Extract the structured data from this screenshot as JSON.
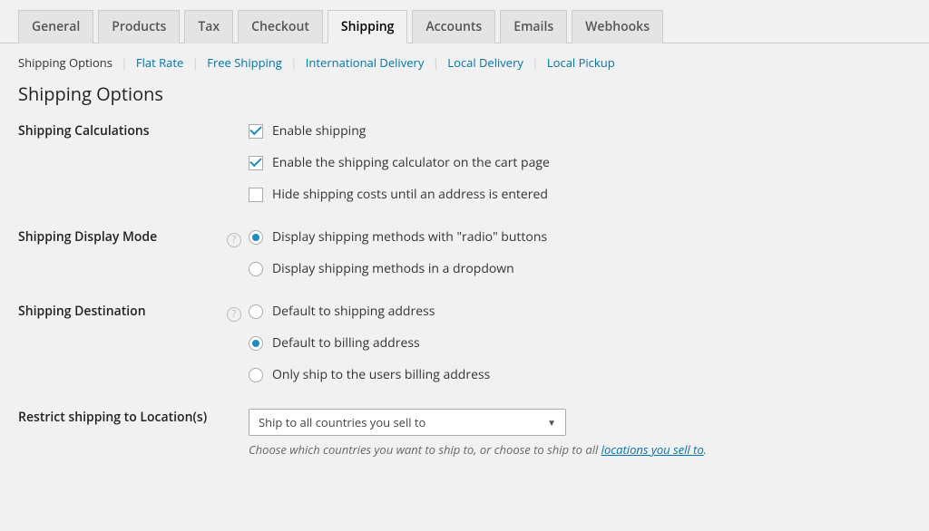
{
  "tabs": {
    "general": "General",
    "products": "Products",
    "tax": "Tax",
    "checkout": "Checkout",
    "shipping": "Shipping",
    "accounts": "Accounts",
    "emails": "Emails",
    "webhooks": "Webhooks"
  },
  "subtabs": {
    "shipping_options": "Shipping Options",
    "flat_rate": "Flat Rate",
    "free_shipping": "Free Shipping",
    "international_delivery": "International Delivery",
    "local_delivery": "Local Delivery",
    "local_pickup": "Local Pickup"
  },
  "section_title": "Shipping Options",
  "rows": {
    "calculations": {
      "label": "Shipping Calculations",
      "enable_shipping": "Enable shipping",
      "enable_calculator": "Enable the shipping calculator on the cart page",
      "hide_costs": "Hide shipping costs until an address is entered"
    },
    "display_mode": {
      "label": "Shipping Display Mode",
      "radio_buttons": "Display shipping methods with \"radio\" buttons",
      "dropdown": "Display shipping methods in a dropdown"
    },
    "destination": {
      "label": "Shipping Destination",
      "default_shipping": "Default to shipping address",
      "default_billing": "Default to billing address",
      "only_billing": "Only ship to the users billing address"
    },
    "restrict": {
      "label": "Restrict shipping to Location(s)",
      "selected": "Ship to all countries you sell to",
      "description_pre": "Choose which countries you want to ship to, or choose to ship to all ",
      "description_link": "locations you sell to",
      "description_post": "."
    }
  }
}
